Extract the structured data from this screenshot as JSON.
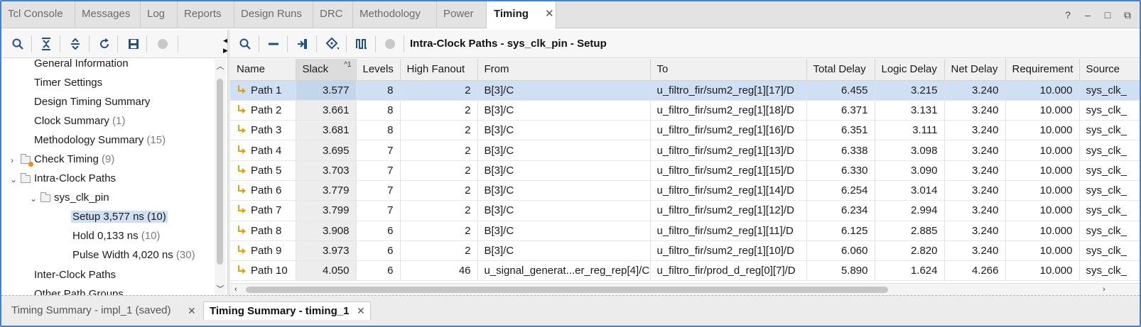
{
  "top_tabs": [
    {
      "label": "Tcl Console"
    },
    {
      "label": "Messages"
    },
    {
      "label": "Log"
    },
    {
      "label": "Reports"
    },
    {
      "label": "Design Runs"
    },
    {
      "label": "DRC"
    },
    {
      "label": "Methodology"
    },
    {
      "label": "Power"
    },
    {
      "label": "Timing",
      "active": true
    }
  ],
  "window_controls": {
    "help": "?",
    "minimize": "–",
    "restore": "□",
    "popout": "⧉"
  },
  "left_toolbar_icons": [
    "search-icon",
    "collapse-all-icon",
    "expand-all-icon",
    "refresh-icon",
    "save-icon",
    "stop-icon"
  ],
  "tree": [
    {
      "label": "General Information",
      "count": ""
    },
    {
      "label": "Timer Settings",
      "count": ""
    },
    {
      "label": "Design Timing Summary",
      "count": ""
    },
    {
      "label": "Clock Summary",
      "count": "(1)"
    },
    {
      "label": "Methodology Summary",
      "count": "(15)"
    },
    {
      "label": "Check Timing",
      "count": "(9)"
    },
    {
      "label": "Intra-Clock Paths",
      "count": ""
    },
    {
      "label": "sys_clk_pin",
      "count": ""
    },
    {
      "label": "Setup 3,577 ns",
      "count": "(10)",
      "selected": true
    },
    {
      "label": "Hold 0,133 ns",
      "count": "(10)"
    },
    {
      "label": "Pulse Width 4,020 ns",
      "count": "(30)"
    },
    {
      "label": "Inter-Clock Paths",
      "count": ""
    },
    {
      "label": "Other Path Groups",
      "count": ""
    }
  ],
  "right_toolbar": {
    "icons": [
      "search-icon",
      "collapse-icon",
      "goto-icon",
      "schematic-icon",
      "waveform-icon",
      "stop-icon"
    ],
    "title": "Intra-Clock Paths - sys_clk_pin - Setup"
  },
  "table": {
    "columns": [
      "Name",
      "Slack",
      "Levels",
      "High Fanout",
      "From",
      "To",
      "Total Delay",
      "Logic Delay",
      "Net Delay",
      "Requirement",
      "Source"
    ],
    "sort_indicator": "^1",
    "rows": [
      {
        "name": "Path 1",
        "slack": "3.577",
        "levels": "8",
        "fanout": "2",
        "from": "B[3]/C",
        "to": "u_filtro_fir/sum2_reg[1][17]/D",
        "total": "6.455",
        "logic": "3.215",
        "net": "3.240",
        "req": "10.000",
        "source": "sys_clk_",
        "selected": true
      },
      {
        "name": "Path 2",
        "slack": "3.661",
        "levels": "8",
        "fanout": "2",
        "from": "B[3]/C",
        "to": "u_filtro_fir/sum2_reg[1][18]/D",
        "total": "6.371",
        "logic": "3.131",
        "net": "3.240",
        "req": "10.000",
        "source": "sys_clk_"
      },
      {
        "name": "Path 3",
        "slack": "3.681",
        "levels": "8",
        "fanout": "2",
        "from": "B[3]/C",
        "to": "u_filtro_fir/sum2_reg[1][16]/D",
        "total": "6.351",
        "logic": "3.111",
        "net": "3.240",
        "req": "10.000",
        "source": "sys_clk_"
      },
      {
        "name": "Path 4",
        "slack": "3.695",
        "levels": "7",
        "fanout": "2",
        "from": "B[3]/C",
        "to": "u_filtro_fir/sum2_reg[1][13]/D",
        "total": "6.338",
        "logic": "3.098",
        "net": "3.240",
        "req": "10.000",
        "source": "sys_clk_"
      },
      {
        "name": "Path 5",
        "slack": "3.703",
        "levels": "7",
        "fanout": "2",
        "from": "B[3]/C",
        "to": "u_filtro_fir/sum2_reg[1][15]/D",
        "total": "6.330",
        "logic": "3.090",
        "net": "3.240",
        "req": "10.000",
        "source": "sys_clk_"
      },
      {
        "name": "Path 6",
        "slack": "3.779",
        "levels": "7",
        "fanout": "2",
        "from": "B[3]/C",
        "to": "u_filtro_fir/sum2_reg[1][14]/D",
        "total": "6.254",
        "logic": "3.014",
        "net": "3.240",
        "req": "10.000",
        "source": "sys_clk_"
      },
      {
        "name": "Path 7",
        "slack": "3.799",
        "levels": "7",
        "fanout": "2",
        "from": "B[3]/C",
        "to": "u_filtro_fir/sum2_reg[1][12]/D",
        "total": "6.234",
        "logic": "2.994",
        "net": "3.240",
        "req": "10.000",
        "source": "sys_clk_"
      },
      {
        "name": "Path 8",
        "slack": "3.908",
        "levels": "6",
        "fanout": "2",
        "from": "B[3]/C",
        "to": "u_filtro_fir/sum2_reg[1][11]/D",
        "total": "6.125",
        "logic": "2.885",
        "net": "3.240",
        "req": "10.000",
        "source": "sys_clk_"
      },
      {
        "name": "Path 9",
        "slack": "3.973",
        "levels": "6",
        "fanout": "2",
        "from": "B[3]/C",
        "to": "u_filtro_fir/sum2_reg[1][10]/D",
        "total": "6.060",
        "logic": "2.820",
        "net": "3.240",
        "req": "10.000",
        "source": "sys_clk_"
      },
      {
        "name": "Path 10",
        "slack": "4.050",
        "levels": "6",
        "fanout": "46",
        "from": "u_signal_generat...er_reg_rep[4]/C",
        "to": "u_filtro_fir/prod_d_reg[0][7]/D",
        "total": "5.890",
        "logic": "1.624",
        "net": "4.266",
        "req": "10.000",
        "source": "sys_clk_"
      }
    ]
  },
  "bottom_tabs": [
    {
      "label": "Timing Summary - impl_1 (saved)"
    },
    {
      "label": "Timing Summary - timing_1",
      "active": true
    }
  ],
  "colors": {
    "accent_border": "#4a7fc4",
    "selection": "#cfe0f5",
    "path_icon": "#e6a100",
    "warning": "#f08a1d"
  }
}
